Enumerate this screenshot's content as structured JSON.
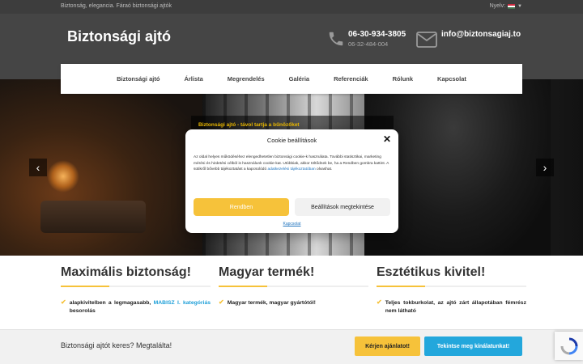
{
  "topbar": {
    "tagline": "Biztonság, elegancia. Fáraó biztonsági ajtók",
    "language_label": "Nyelv:"
  },
  "header": {
    "logo": "Biztonsági ajtó",
    "phone_primary": "06-30-934-3805",
    "phone_secondary": "06-32-484-004",
    "email": "info@biztonsagiaj.to"
  },
  "nav": {
    "items": [
      "Biztonsági ajtó",
      "Árlista",
      "Megrendelés",
      "Galéria",
      "Referenciák",
      "Rólunk",
      "Kapcsolat"
    ]
  },
  "hero": {
    "caption": "Biztonsági ajtó - távol tartja a bűnözőket"
  },
  "cookie_modal": {
    "title": "Cookie beállítások",
    "text": "Az oldal helyes működéséhez elengedhetetlen biztonsági cookie-k használata. További statisztikai, marketing mérési és hirdetési célból is használunk cookie-kat. Utóbbiak, akkor töltődnek be, ha a Rendben gombra kattint. A sütikről bővebb tájékoztatást a kapcsolódó",
    "link_text": "adatkezelési tájékoztatóban",
    "text_end": "olvashat.",
    "accept_label": "Rendben",
    "settings_label": "Beállítások megtekintése",
    "contact_link": "Kapcsolat"
  },
  "features": [
    {
      "title": "Maximális biztonság!",
      "text_before": "alapkivitelben a legmagasabb,",
      "highlight": "MABISZ I. kategóriás",
      "text_after": "besorolás"
    },
    {
      "title": "Magyar termék!",
      "text": "Magyar termék, magyar gyártótól!"
    },
    {
      "title": "Esztétikus kivitel!",
      "text": "Teljes tokburkolat, az ajtó zárt állapotában fémrész nem látható"
    }
  ],
  "footer": {
    "question": "Biztonsági ajtót keres? Megtalálta!",
    "quote_button": "Kérjen ajánlatot!",
    "offers_button": "Tekintse meg kínálatunkat!"
  },
  "colors": {
    "accent_yellow": "#f6c23a",
    "accent_blue": "#23a7dc",
    "header_bg": "#454545"
  }
}
